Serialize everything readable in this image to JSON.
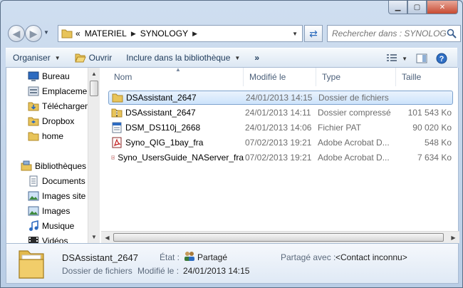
{
  "address": {
    "segments": [
      "MATERIEL",
      "SYNOLOGY"
    ],
    "prefix": "«"
  },
  "search": {
    "placeholder": "Rechercher dans : SYNOLOGY"
  },
  "toolbar": {
    "organize": "Organiser",
    "open": "Ouvrir",
    "include": "Inclure dans la bibliothèque",
    "more": "»"
  },
  "nav": {
    "items": [
      {
        "label": "Bureau",
        "icon": "desktop-icon"
      },
      {
        "label": "Emplacements",
        "icon": "places-icon"
      },
      {
        "label": "Téléchargements",
        "icon": "downloads-icon"
      },
      {
        "label": "Dropbox",
        "icon": "dropbox-icon"
      },
      {
        "label": "home",
        "icon": "folder-icon"
      },
      {
        "label": "Bibliothèques",
        "icon": "libraries-icon"
      },
      {
        "label": "Documents",
        "icon": "documents-icon"
      },
      {
        "label": "Images site",
        "icon": "images-icon"
      },
      {
        "label": "Images",
        "icon": "images-icon"
      },
      {
        "label": "Musique",
        "icon": "music-icon"
      },
      {
        "label": "Vidéos",
        "icon": "videos-icon"
      }
    ]
  },
  "columns": {
    "name": "Nom",
    "date": "Modifié le",
    "type": "Type",
    "size": "Taille"
  },
  "files": [
    {
      "name": "DSAssistant_2647",
      "date": "24/01/2013 14:15",
      "type": "Dossier de fichiers",
      "size": "",
      "icon": "folder-icon"
    },
    {
      "name": "DSAssistant_2647",
      "date": "24/01/2013 14:11",
      "type": "Dossier compressé",
      "size": "101 543 Ko",
      "icon": "zip-folder-icon"
    },
    {
      "name": "DSM_DS110j_2668",
      "date": "24/01/2013 14:06",
      "type": "Fichier PAT",
      "size": "90 020 Ko",
      "icon": "pat-file-icon"
    },
    {
      "name": "Syno_QIG_1bay_fra",
      "date": "07/02/2013 19:21",
      "type": "Adobe Acrobat D...",
      "size": "548 Ko",
      "icon": "pdf-icon"
    },
    {
      "name": "Syno_UsersGuide_NAServer_fra",
      "date": "07/02/2013 19:21",
      "type": "Adobe Acrobat D...",
      "size": "7 634 Ko",
      "icon": "pdf-icon"
    }
  ],
  "details": {
    "name": "DSAssistant_2647",
    "type": "Dossier de fichiers",
    "state_label": "État :",
    "state_value": "Partagé",
    "shared_label": "Partagé avec :",
    "shared_value": "<Contact inconnu>",
    "modified_label": "Modifié le :",
    "modified_value": "24/01/2013 14:15"
  }
}
